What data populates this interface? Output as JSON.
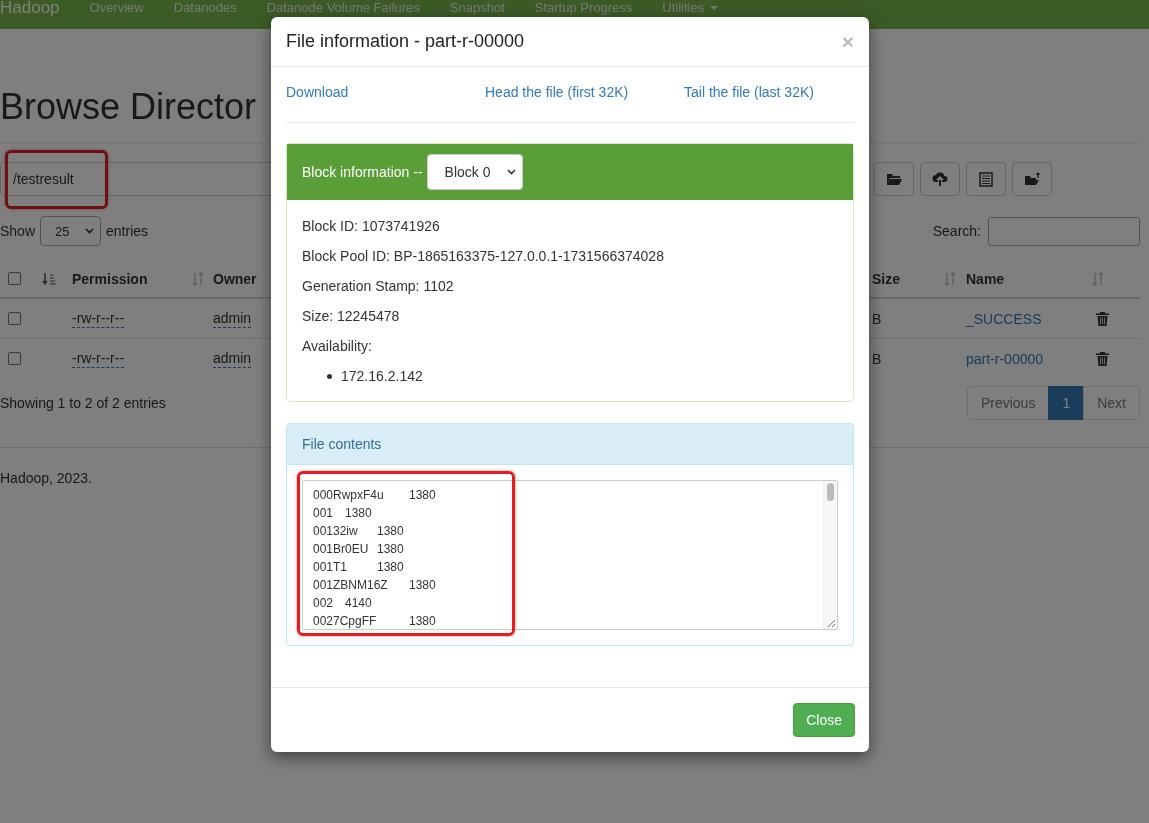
{
  "navbar": {
    "brand": "Hadoop",
    "items": [
      {
        "label": "Overview",
        "dropdown": false
      },
      {
        "label": "Datanodes",
        "dropdown": false
      },
      {
        "label": "Datanode Volume Failures",
        "dropdown": false
      },
      {
        "label": "Snapshot",
        "dropdown": false
      },
      {
        "label": "Startup Progress",
        "dropdown": false
      },
      {
        "label": "Utilities",
        "dropdown": true
      }
    ]
  },
  "page": {
    "title": "Browse Director",
    "path": "/testresult",
    "length_menu": {
      "before": "Show",
      "value": "25",
      "after": "entries"
    },
    "search": {
      "label": "Search:"
    },
    "table": {
      "checked": false,
      "columns": [
        "Permission",
        "Owner",
        "Size",
        "Name"
      ],
      "rows": [
        {
          "checked": false,
          "permission": "-rw-r--r--",
          "owner": "admin",
          "size": "B",
          "name": "_SUCCESS"
        },
        {
          "checked": false,
          "permission": "-rw-r--r--",
          "owner": "admin",
          "size": "B",
          "name": "part-r-00000"
        }
      ]
    },
    "info": "Showing 1 to 2 of 2 entries",
    "pagination": [
      {
        "label": "Previous",
        "selected": false
      },
      {
        "label": "1",
        "selected": true
      },
      {
        "label": "Next",
        "selected": false
      }
    ],
    "footer": "Hadoop, 2023."
  },
  "modal": {
    "title": "File information - part-r-00000",
    "close": "×",
    "links": [
      "Download",
      "Head the file (first 32K)",
      "Tail the file (last 32K)"
    ],
    "block_panel": {
      "heading": "Block information --",
      "select": "Block 0",
      "fields": [
        "Block ID: 1073741926",
        "Block Pool ID: BP-1865163375-127.0.0.1-1731566374028",
        "Generation Stamp: 1102",
        "Size: 12245478",
        "Availability:"
      ],
      "hosts": [
        "172.16.2.142"
      ]
    },
    "contents_panel": {
      "heading": "File contents",
      "lines": [
        "000RwpxF4u\t1380",
        "001\t1380",
        "00132iw\t1380",
        "001Br0EU\t1380",
        "001T1\t1380",
        "001ZBNM16Z\t1380",
        "002\t4140",
        "0027CpgFF\t1380"
      ]
    },
    "button": "Close"
  }
}
